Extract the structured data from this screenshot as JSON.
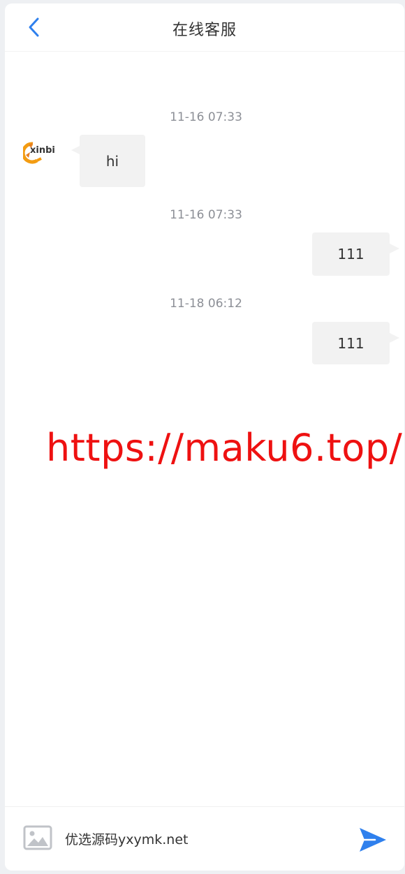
{
  "header": {
    "title": "在线客服",
    "back_icon": "chevron-left-icon"
  },
  "messages": [
    {
      "time": "11-16 07:33",
      "side": "left",
      "text": "hi",
      "avatar_text": "xinbi"
    },
    {
      "time": "11-16 07:33",
      "side": "right",
      "text": "111"
    },
    {
      "time": "11-18 06:12",
      "side": "right",
      "text": "111"
    }
  ],
  "watermark": "https://maku6.top/",
  "footer": {
    "input_value": "优选源码yxymk.net",
    "image_icon": "image-icon",
    "send_icon": "send-icon"
  },
  "colors": {
    "accent": "#2f80ed",
    "bubble": "#f2f2f2",
    "watermark": "#ee1111",
    "avatar_orange": "#f39c12"
  }
}
